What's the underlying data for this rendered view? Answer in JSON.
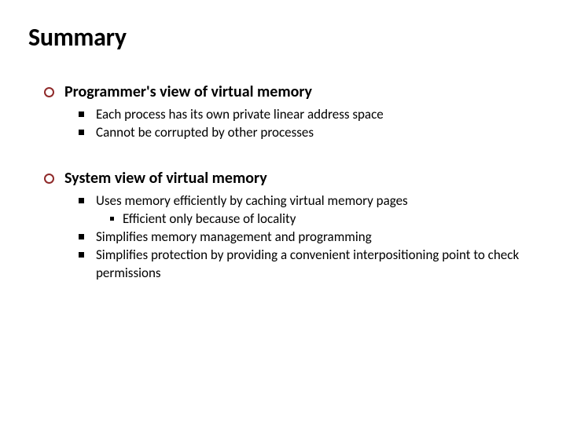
{
  "title": "Summary",
  "sections": [
    {
      "heading": "Programmer's view of virtual memory",
      "points": [
        {
          "text": "Each process has its own private linear address space"
        },
        {
          "text": "Cannot be corrupted by other processes"
        }
      ]
    },
    {
      "heading": "System view of virtual memory",
      "points": [
        {
          "text": "Uses memory efficiently by caching virtual memory pages",
          "subpoints": [
            {
              "text": "Efficient only because of locality"
            }
          ]
        },
        {
          "text": "Simplifies memory management and programming"
        },
        {
          "text": "Simplifies protection by providing a convenient interpositioning point to check permissions"
        }
      ]
    }
  ]
}
